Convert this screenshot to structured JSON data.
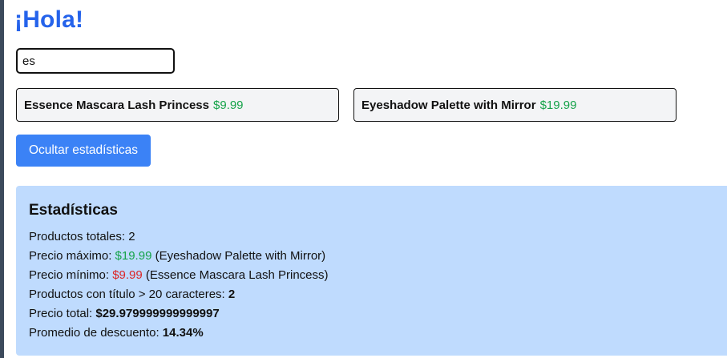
{
  "greeting": "¡Hola!",
  "search": {
    "value": "es"
  },
  "products": [
    {
      "name": "Essence Mascara Lash Princess",
      "price": "$9.99"
    },
    {
      "name": "Eyeshadow Palette with Mirror",
      "price": "$19.99"
    }
  ],
  "toggle_button": {
    "label": "Ocultar estadísticas"
  },
  "stats": {
    "title": "Estadísticas",
    "total_products_label": "Productos totales: ",
    "total_products_value": "2",
    "max_price_label": "Precio máximo: ",
    "max_price_value": "$19.99",
    "max_price_product": " (Eyeshadow Palette with Mirror)",
    "min_price_label": "Precio mínimo: ",
    "min_price_value": "$9.99",
    "min_price_product": " (Essence Mascara Lash Princess)",
    "long_title_label": "Productos con título > 20 caracteres: ",
    "long_title_value": "2",
    "total_price_label": "Precio total: ",
    "total_price_value": "$29.979999999999997",
    "avg_discount_label": "Promedio de descuento: ",
    "avg_discount_value": "14.34%"
  },
  "colors": {
    "accent": "#2563eb",
    "button": "#3b82f6",
    "price_green": "#16a34a",
    "price_red": "#dc2626",
    "stats_bg": "#bfdbfe",
    "card_bg": "#f3f4f6"
  }
}
